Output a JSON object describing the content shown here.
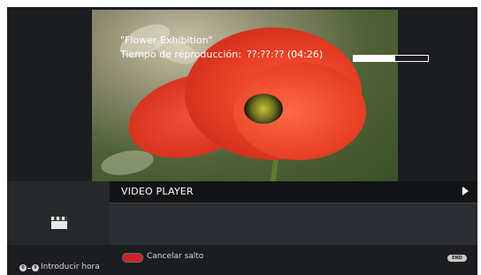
{
  "player": {
    "title": "VIDEO PLAYER",
    "item_title": "\"Flower Exhibition\"",
    "time_label": "Tiempo de reproducción:",
    "time_value": "??:??:?? (04:26)",
    "progress_fraction": 0.56
  },
  "footer": {
    "cancel_label": "Cancelar salto",
    "end_key": "END",
    "num_key_start": "0",
    "num_key_end": "9",
    "enter_time_label": "Introducir hora"
  },
  "colors": {
    "background": "#1b1d20",
    "panel": "#2b2e32",
    "header": "#121416",
    "red_button": "#d0202a"
  },
  "icons": {
    "play": "play-icon",
    "media": "clapperboard-icon"
  }
}
